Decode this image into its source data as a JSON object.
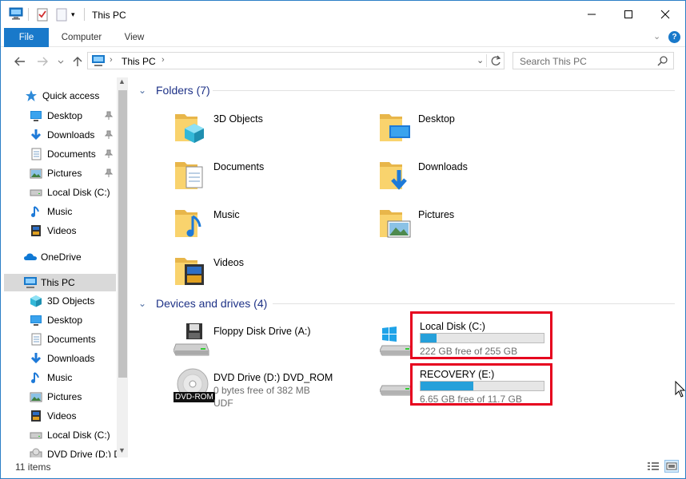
{
  "window": {
    "title": "This PC"
  },
  "caption_buttons": {
    "minimize": "—",
    "maximize": "☐",
    "close": "✕"
  },
  "ribbon": {
    "tabs": [
      {
        "label": "File"
      },
      {
        "label": "Computer"
      },
      {
        "label": "View"
      }
    ],
    "help": "?"
  },
  "address": {
    "path": "This PC",
    "search_placeholder": "Search This PC"
  },
  "sidebar": {
    "quick_access": {
      "label": "Quick access",
      "items": [
        {
          "label": "Desktop",
          "pinned": true,
          "icon": "desktop-icon"
        },
        {
          "label": "Downloads",
          "pinned": true,
          "icon": "downloads-icon"
        },
        {
          "label": "Documents",
          "pinned": true,
          "icon": "documents-icon"
        },
        {
          "label": "Pictures",
          "pinned": true,
          "icon": "pictures-icon"
        },
        {
          "label": "Local Disk (C:)",
          "pinned": false,
          "icon": "drive-icon"
        },
        {
          "label": "Music",
          "pinned": false,
          "icon": "music-icon"
        },
        {
          "label": "Videos",
          "pinned": false,
          "icon": "videos-icon"
        }
      ]
    },
    "onedrive": {
      "label": "OneDrive"
    },
    "this_pc": {
      "label": "This PC",
      "items": [
        {
          "label": "3D Objects",
          "icon": "3d-objects-icon"
        },
        {
          "label": "Desktop",
          "icon": "desktop-icon"
        },
        {
          "label": "Documents",
          "icon": "documents-icon"
        },
        {
          "label": "Downloads",
          "icon": "downloads-icon"
        },
        {
          "label": "Music",
          "icon": "music-icon"
        },
        {
          "label": "Pictures",
          "icon": "pictures-icon"
        },
        {
          "label": "Videos",
          "icon": "videos-icon"
        },
        {
          "label": "Local Disk (C:)",
          "icon": "drive-icon"
        },
        {
          "label": "DVD Drive (D:) D",
          "icon": "dvd-icon"
        }
      ]
    }
  },
  "folders": {
    "header": "Folders (7)",
    "items": [
      {
        "label": "3D Objects",
        "icon": "3d-objects-icon"
      },
      {
        "label": "Desktop",
        "icon": "desktop-icon"
      },
      {
        "label": "Documents",
        "icon": "documents-icon"
      },
      {
        "label": "Downloads",
        "icon": "downloads-icon"
      },
      {
        "label": "Music",
        "icon": "music-icon"
      },
      {
        "label": "Pictures",
        "icon": "pictures-icon"
      },
      {
        "label": "Videos",
        "icon": "videos-icon"
      }
    ]
  },
  "devices": {
    "header": "Devices and drives (4)",
    "floppy": {
      "label": "Floppy Disk Drive (A:)"
    },
    "dvd": {
      "label": "DVD Drive (D:) DVD_ROM",
      "free": "0 bytes free of 382 MB",
      "fs": "UDF",
      "badge": "DVD-ROM"
    },
    "local_c": {
      "label": "Local Disk (C:)",
      "free": "222 GB free of 255 GB",
      "used_fraction": 0.13
    },
    "recovery": {
      "label": "RECOVERY (E:)",
      "free": "6.65 GB free of 11.7 GB",
      "used_fraction": 0.43
    }
  },
  "status": {
    "items": "11 items"
  },
  "colors": {
    "accent": "#1979ca",
    "highlight": "#e6001e",
    "bar": "#26a0da"
  }
}
